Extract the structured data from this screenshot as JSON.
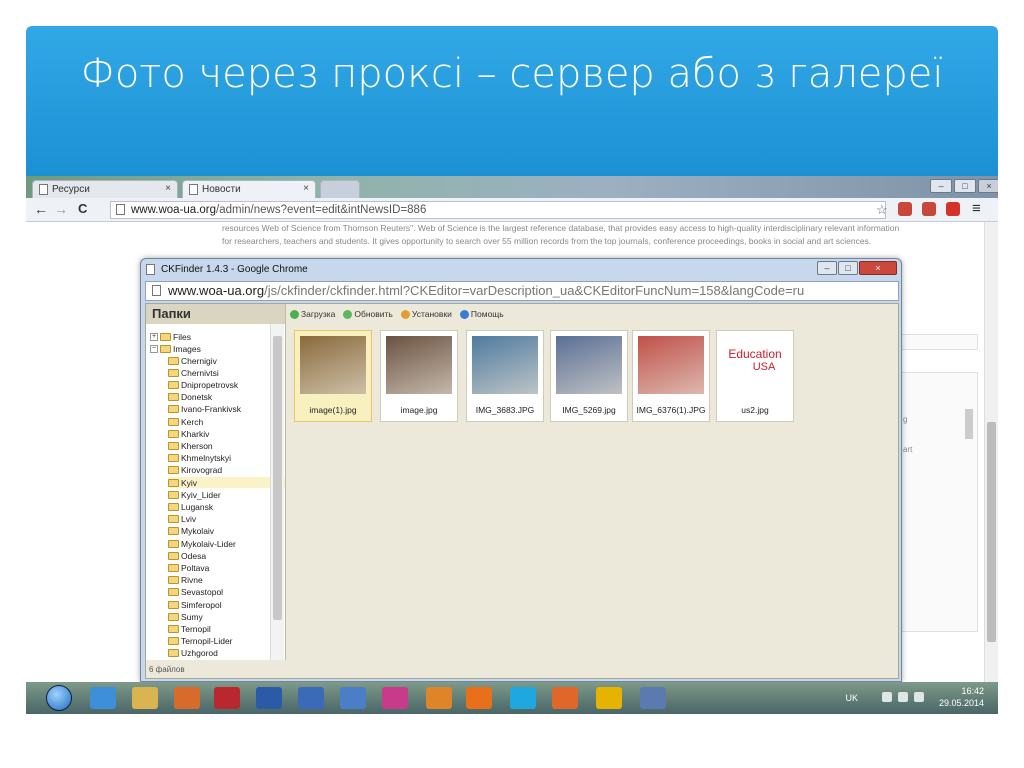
{
  "slide": {
    "title": "Фото через проксі – сервер або з галереї"
  },
  "browser": {
    "tabs": [
      {
        "label": "Ресурси"
      },
      {
        "label": "Новости"
      }
    ],
    "address": {
      "prefix": "www.woa-ua.org",
      "rest": "/admin/news?event=edit&intNewsID=886"
    },
    "nav": {
      "back": "←",
      "forward": "→",
      "reload": "C",
      "star": "☆",
      "menu": "≡"
    }
  },
  "page": {
    "text_line1": "resources Web of Science from Thomson Reuters\". Web of Science is the largest reference database, that provides easy access to high-quality interdisciplinary relevant information",
    "text_line2": "for researchers, teachers and students. It gives opportunity to search over 55 million records from the top journals, conference proceedings, books in social and art sciences.",
    "side_frag1": "g",
    "side_frag2": "art"
  },
  "dialog": {
    "title": "CKFinder 1.4.3 - Google Chrome",
    "url_prefix": "www.woa-ua.org",
    "url_rest": "/js/ckfinder/ckfinder.html?CKEditor=varDescription_ua&CKEditorFuncNum=158&langCode=ru",
    "folders_header": "Папки",
    "toolbar": [
      {
        "label": "Загрузка",
        "color": "#4caf50"
      },
      {
        "label": "Обновить",
        "color": "#5cb85c"
      },
      {
        "label": "Установки",
        "color": "#e0a030"
      },
      {
        "label": "Помощь",
        "color": "#3a7bd5"
      }
    ],
    "tree": {
      "files": "Files",
      "images": "Images",
      "folders": [
        "Chernigiv",
        "Chernivtsi",
        "Dnipropetrovsk",
        "Donetsk",
        "Ivano-Frankivsk",
        "Kerch",
        "Kharkiv",
        "Kherson",
        "Khmelnytskyi",
        "Kirovograd",
        "Kyiv",
        "Kyiv_Lider",
        "Lugansk",
        "Lviv",
        "Mykolaiv",
        "Mykolaiv-Lider",
        "Odesa",
        "Poltava",
        "Rivne",
        "Sevastopol",
        "Simferopol",
        "Sumy",
        "Ternopil",
        "Ternopil-Lider",
        "Uzhgorod"
      ],
      "selected": "Kyiv"
    },
    "status": "6 файлов",
    "files": [
      {
        "name": "image(1).jpg",
        "color": "#8a6a3c"
      },
      {
        "name": "image.jpg",
        "color": "#6b5242"
      },
      {
        "name": "IMG_3683.JPG",
        "color": "#4f7aa0"
      },
      {
        "name": "IMG_5269.jpg",
        "color": "#5a6f96"
      },
      {
        "name": "IMG_6376(1).JPG",
        "color": "#c0504a"
      },
      {
        "name": "us2.jpg",
        "logo1": "Education",
        "logo2": "USA",
        "color": "#c8202c"
      }
    ]
  },
  "taskbar": {
    "lang": "UK",
    "time": "16:42",
    "date": "29.05.2014"
  }
}
